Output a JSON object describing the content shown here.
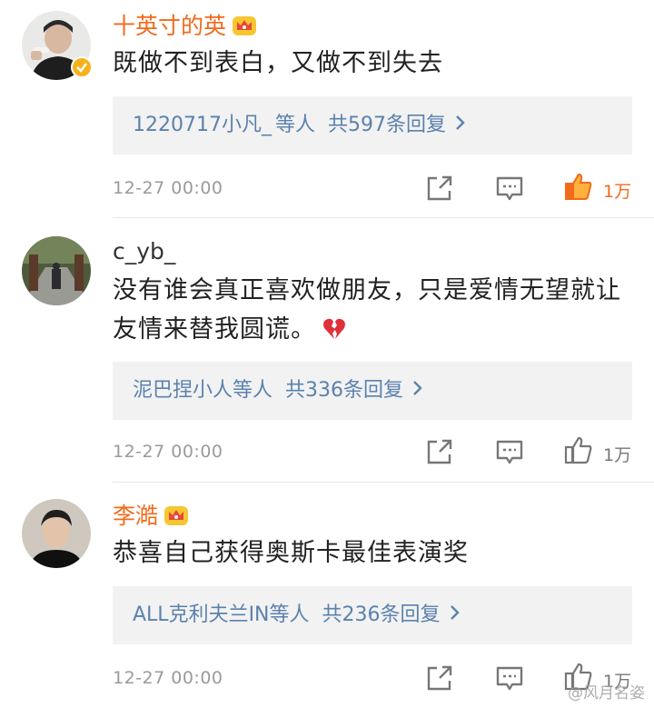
{
  "comments": [
    {
      "user": "十英寸的英",
      "vip": true,
      "verified": true,
      "text": "既做不到表白，又做不到失去",
      "reply_users": "1220717小凡_",
      "reply_etc": "等人",
      "reply_total": "共597条回复",
      "time": "12-27 00:00",
      "likes": "1万",
      "liked": true
    },
    {
      "user": "c_yb_",
      "vip": false,
      "verified": false,
      "text": "没有谁会真正喜欢做朋友，只是爱情无望就让友情来替我圆谎。",
      "emoji": "broken-heart",
      "reply_users": "泥巴捏小人",
      "reply_etc": "等人",
      "reply_total": "共336条回复",
      "time": "12-27 00:00",
      "likes": "1万",
      "liked": false
    },
    {
      "user": "李澔",
      "vip": true,
      "verified": false,
      "text": "恭喜自己获得奥斯卡最佳表演奖",
      "reply_users": "ALL克利夫兰IN",
      "reply_etc": "等人",
      "reply_total": "共236条回复",
      "time": "12-27 00:00",
      "likes": "1万",
      "liked": false
    }
  ],
  "watermark": "@风月名姿",
  "colors": {
    "vip_name": "#f26a1b",
    "link": "#5b82ad",
    "liked": "#f26a1b"
  },
  "icons": [
    "share-icon",
    "comment-icon",
    "like-icon",
    "crown-icon",
    "verified-icon",
    "broken-heart-emoji"
  ]
}
